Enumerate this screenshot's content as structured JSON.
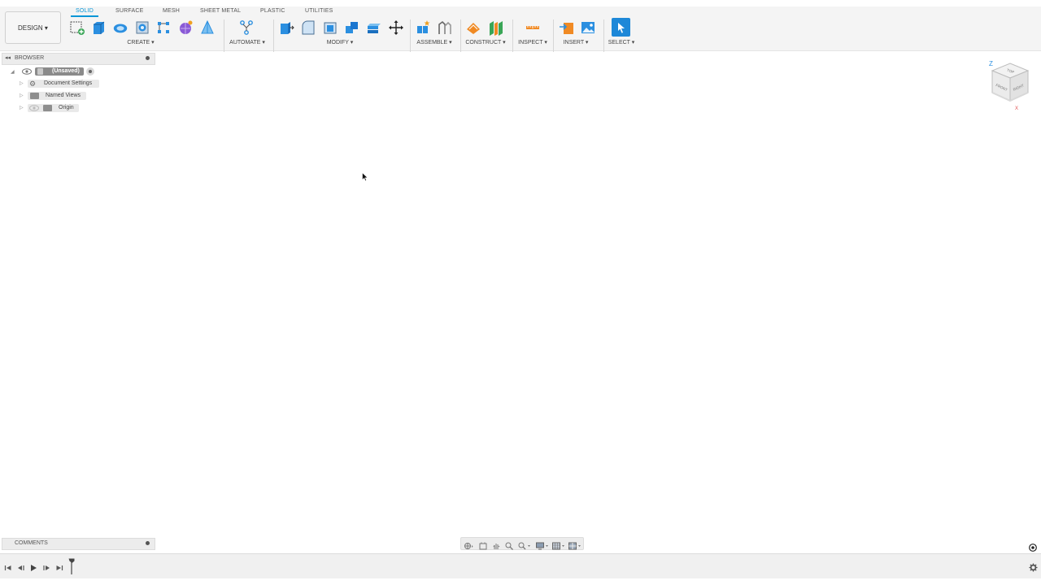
{
  "workspace": {
    "label": "DESIGN ▾"
  },
  "tabs": [
    {
      "label": "SOLID",
      "active": true
    },
    {
      "label": "SURFACE"
    },
    {
      "label": "MESH"
    },
    {
      "label": "SHEET METAL"
    },
    {
      "label": "PLASTIC"
    },
    {
      "label": "UTILITIES"
    }
  ],
  "groups": {
    "create": "CREATE ▾",
    "automate": "AUTOMATE ▾",
    "modify": "MODIFY ▾",
    "assemble": "ASSEMBLE ▾",
    "construct": "CONSTRUCT ▾",
    "inspect": "INSPECT ▾",
    "insert": "INSERT ▾",
    "select": "SELECT ▾"
  },
  "browser": {
    "title": "BROWSER",
    "root": "(Unsaved)",
    "items": [
      "Document Settings",
      "Named Views",
      "Origin"
    ]
  },
  "comments": {
    "title": "COMMENTS"
  },
  "viewcube": {
    "z": "Z",
    "x": "X",
    "top": "TOP",
    "front": "FRONT",
    "right": "RIGHT"
  },
  "colors": {
    "accent": "#0696d7",
    "blue_icon": "#2b8fe0",
    "orange": "#f08a24",
    "green": "#3aa657"
  }
}
